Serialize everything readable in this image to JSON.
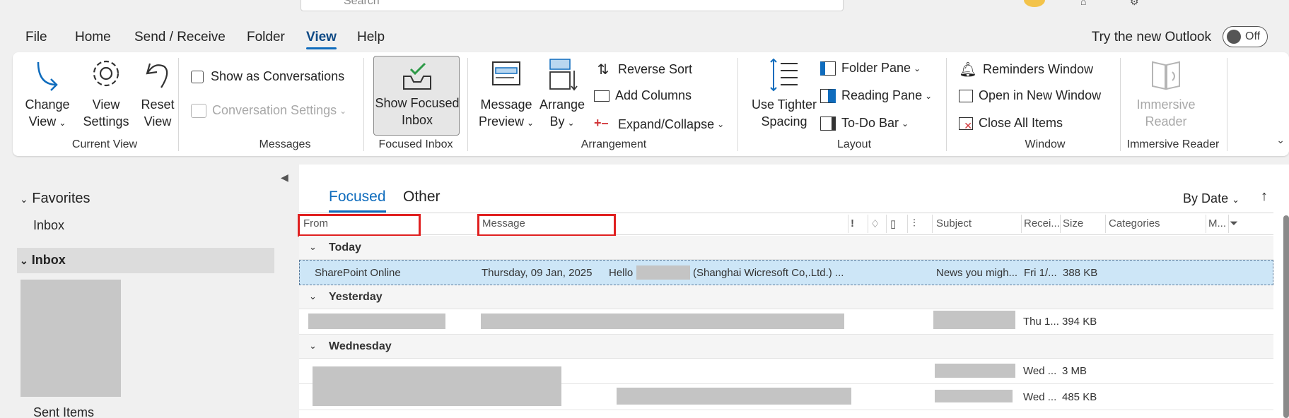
{
  "search": {
    "placeholder": "Search"
  },
  "menu": {
    "tabs": [
      "File",
      "Home",
      "Send / Receive",
      "Folder",
      "View",
      "Help"
    ],
    "active": "View",
    "try_new": "Try the new Outlook",
    "toggle_label": "Off"
  },
  "ribbon": {
    "current_view": {
      "label": "Current View",
      "change_view": [
        "Change",
        "View"
      ],
      "view_settings": [
        "View",
        "Settings"
      ],
      "reset_view": [
        "Reset",
        "View"
      ]
    },
    "messages": {
      "label": "Messages",
      "show_as_conversations": "Show as Conversations",
      "conversation_settings": "Conversation Settings"
    },
    "focused_inbox": {
      "label": "Focused Inbox",
      "show_focused": [
        "Show Focused",
        "Inbox"
      ]
    },
    "arrangement": {
      "label": "Arrangement",
      "message_preview": [
        "Message",
        "Preview"
      ],
      "arrange_by": [
        "Arrange",
        "By"
      ],
      "reverse_sort": "Reverse Sort",
      "add_columns": "Add Columns",
      "expand_collapse": "Expand/Collapse"
    },
    "layout": {
      "label": "Layout",
      "use_tighter": [
        "Use Tighter",
        "Spacing"
      ],
      "folder_pane": "Folder Pane",
      "reading_pane": "Reading Pane",
      "todo_bar": "To-Do Bar"
    },
    "window": {
      "label": "Window",
      "reminders": "Reminders Window",
      "open_new": "Open in New Window",
      "close_all": "Close All Items"
    },
    "immersive": {
      "label": "Immersive Reader",
      "button": [
        "Immersive",
        "Reader"
      ]
    }
  },
  "nav": {
    "favorites": "Favorites",
    "fav_inbox": "Inbox",
    "inbox": "Inbox",
    "sent_items": "Sent Items"
  },
  "list": {
    "tabs": {
      "focused": "Focused",
      "other": "Other"
    },
    "sort": "By Date",
    "columns": {
      "from": "From",
      "message": "Message",
      "importance": "!",
      "subject": "Subject",
      "received": "Recei...",
      "size": "Size",
      "categories": "Categories",
      "mention": "M..."
    },
    "groups": {
      "today": "Today",
      "yesterday": "Yesterday",
      "wednesday": "Wednesday"
    },
    "rows": [
      {
        "from": "SharePoint Online",
        "date": "Thursday, 09 Jan, 2025",
        "preview_a": "Hello",
        "preview_b": "(Shanghai Wicresoft Co,.Ltd.) ...",
        "subject": "News you migh...",
        "received": "Fri 1/...",
        "size": "388 KB"
      },
      {
        "received": "Thu 1...",
        "size": "394 KB"
      },
      {
        "received": "Wed ...",
        "size": "3 MB"
      },
      {
        "received": "Wed ...",
        "size": "485 KB"
      }
    ]
  },
  "colors": {
    "accent": "#0f6cbd",
    "selected_row": "#cde6f7",
    "highlight_box": "#e02020"
  }
}
